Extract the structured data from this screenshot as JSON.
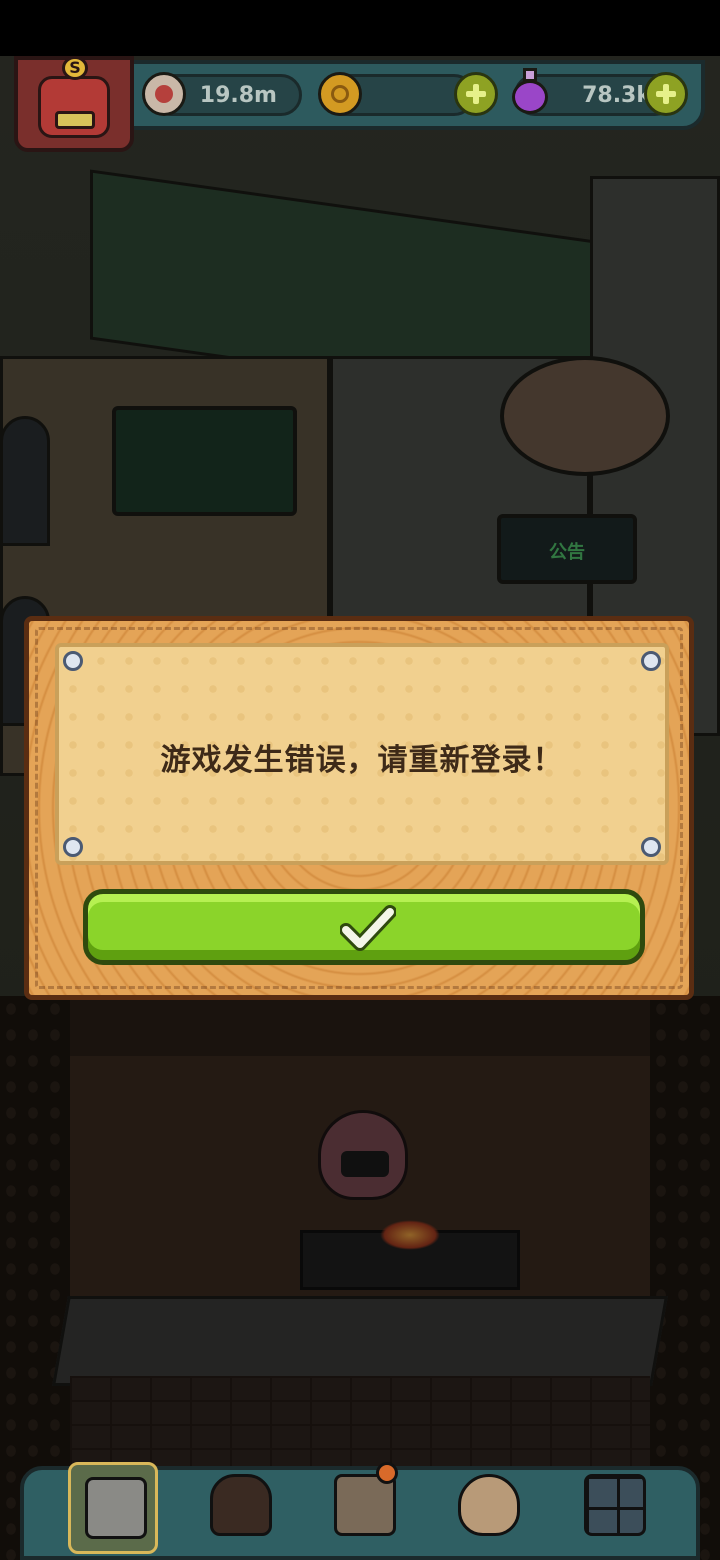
{
  "hud": {
    "eyeball_value": "19.8m",
    "coin_value": "",
    "potion_value": "78.3k",
    "badge_letter": "S"
  },
  "scene": {
    "notice_sign": "公告"
  },
  "dialog": {
    "message": "游戏发生错误，请重新登录！"
  },
  "colors": {
    "confirm_button": "#8bd42a",
    "dialog_wood": "#e09a4c",
    "dialog_paper": "#f1d08f",
    "hud_teal": "#2d5a5e"
  },
  "bottom_nav": {
    "items": [
      {
        "icon": "building-icon",
        "active": true
      },
      {
        "icon": "monster-icon",
        "active": false
      },
      {
        "icon": "book-icon",
        "active": false
      },
      {
        "icon": "money-bag-icon",
        "active": false
      },
      {
        "icon": "grid-icon",
        "active": false
      }
    ]
  }
}
